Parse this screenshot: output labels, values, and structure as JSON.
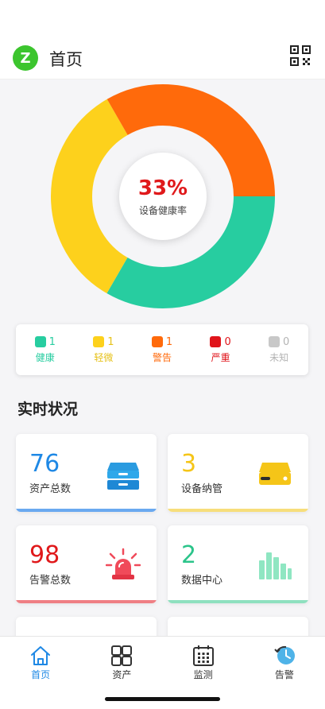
{
  "header": {
    "logo_letter": "Z",
    "title": "首页",
    "qr_icon": "qr-code-scan-icon"
  },
  "health": {
    "percent_text": "33%",
    "label": "设备健康率",
    "segments": [
      {
        "name": "健康",
        "value": 1,
        "color": "#27cda0"
      },
      {
        "name": "轻微",
        "value": 1,
        "color": "#fdd11c"
      },
      {
        "name": "警告",
        "value": 1,
        "color": "#ff6a0b"
      }
    ]
  },
  "legend": [
    {
      "name": "健康",
      "count": "1",
      "color": "#27cda0",
      "text_color": "#27cda0"
    },
    {
      "name": "轻微",
      "count": "1",
      "color": "#fdd11c",
      "text_color": "#e6c21a"
    },
    {
      "name": "警告",
      "count": "1",
      "color": "#ff6a0b",
      "text_color": "#ff6a0b"
    },
    {
      "name": "严重",
      "count": "0",
      "color": "#e0151b",
      "text_color": "#e0151b"
    },
    {
      "name": "未知",
      "count": "0",
      "color": "#c8c8c8",
      "text_color": "#b4b4b4"
    }
  ],
  "section": {
    "title": "实时状况"
  },
  "cards": [
    {
      "number": "76",
      "label": "资产总数",
      "color": "#1e88e5",
      "bar_color": "#6aa9f0",
      "icon": "inbox-tray-icon"
    },
    {
      "number": "3",
      "label": "设备纳管",
      "color": "#f5c518",
      "bar_color": "#f7de7b",
      "icon": "server-device-icon"
    },
    {
      "number": "98",
      "label": "告警总数",
      "color": "#e0191b",
      "bar_color": "#ef7f84",
      "icon": "alarm-siren-icon"
    },
    {
      "number": "2",
      "label": "数据中心",
      "color": "#2bc48a",
      "bar_color": "#8fe0bf",
      "icon": "data-center-bars-icon"
    }
  ],
  "tabs": [
    {
      "label": "首页",
      "icon": "home-icon",
      "active": true
    },
    {
      "label": "资产",
      "icon": "grid-icon",
      "active": false
    },
    {
      "label": "监测",
      "icon": "calendar-monitor-icon",
      "active": false
    },
    {
      "label": "告警",
      "icon": "clock-history-icon",
      "active": false
    }
  ],
  "colors": {
    "accent": "#1e88e5",
    "inactive_tab": "#333333"
  }
}
